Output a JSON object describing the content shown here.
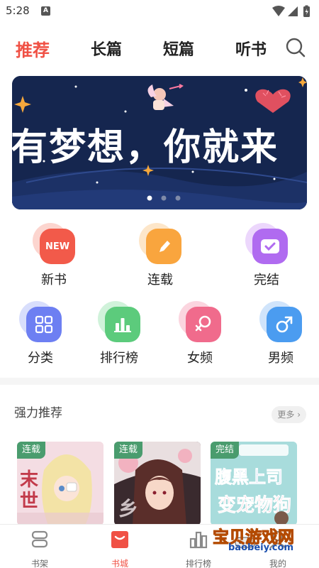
{
  "status": {
    "time": "5:28",
    "notif": "A"
  },
  "tabs": [
    {
      "label": "推荐"
    },
    {
      "label": "长篇"
    },
    {
      "label": "短篇"
    },
    {
      "label": "听书"
    }
  ],
  "banner": {
    "text": "有梦想，你就来",
    "active_dot": 0,
    "dot_count": 3
  },
  "grid_row1": [
    {
      "label": "新书",
      "icon": "new-icon",
      "badge": "NEW",
      "color": "#f25a4a",
      "back": "#fab3a8"
    },
    {
      "label": "连载",
      "icon": "pencil-icon",
      "color": "#f9a53e",
      "back": "#fcd29c"
    },
    {
      "label": "完结",
      "icon": "check-icon",
      "color": "#b06bf0",
      "back": "#dcb6fa"
    }
  ],
  "grid_row2": [
    {
      "label": "分类",
      "icon": "category-icon",
      "color": "#6d7ff2",
      "back": "#b8c2fa"
    },
    {
      "label": "排行榜",
      "icon": "chart-icon",
      "color": "#5ccb7c",
      "back": "#a9e8bb"
    },
    {
      "label": "女频",
      "icon": "female-icon",
      "color": "#f06b8c",
      "back": "#f8b3c4"
    },
    {
      "label": "男频",
      "icon": "male-icon",
      "color": "#4b9cf0",
      "back": "#a9cef8"
    }
  ],
  "section": {
    "title": "强力推荐",
    "more": "更多"
  },
  "books": [
    {
      "badge": "连载"
    },
    {
      "badge": "连载"
    },
    {
      "badge": "完结"
    }
  ],
  "bottom_nav": [
    {
      "label": "书架",
      "icon": "bookshelf-icon"
    },
    {
      "label": "书城",
      "icon": "bookstore-icon",
      "active": true
    },
    {
      "label": "排行榜",
      "icon": "ranking-icon"
    },
    {
      "label": "我的",
      "icon": "profile-icon"
    }
  ],
  "watermark": {
    "text": "宝贝游戏网",
    "url": "baobeiy.com"
  },
  "colors": {
    "accent": "#f05145",
    "banner_bg": "#15264f"
  }
}
